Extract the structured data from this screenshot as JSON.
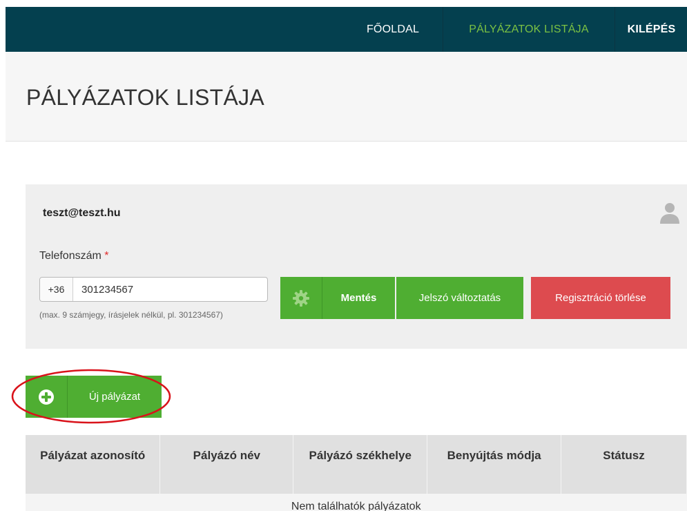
{
  "nav": {
    "home": "FŐOLDAL",
    "list": "PÁLYÁZATOK LISTÁJA",
    "logout": "KILÉPÉS"
  },
  "page": {
    "title": "PÁLYÁZATOK LISTÁJA"
  },
  "profile": {
    "email": "teszt@teszt.hu",
    "phone_label": "Telefonszám",
    "required_mark": "*",
    "prefix": "+36",
    "phone_value": "301234567",
    "hint": "(max. 9 számjegy, írásjelek nélkül, pl. 301234567)",
    "save_label": "Mentés",
    "password_label": "Jelszó változtatás",
    "delete_label": "Regisztráció törlése"
  },
  "actions": {
    "new_label": "Új pályázat"
  },
  "table": {
    "headers": [
      "Pályázat azonosító",
      "Pályázó név",
      "Pályázó székhelye",
      "Benyújtás módja",
      "Státusz"
    ],
    "empty": "Nem találhatók pályázatok"
  },
  "colors": {
    "topbar": "#04404f",
    "nav_active": "#7bc143",
    "button_green": "#4fae32",
    "button_red": "#dd4b4f",
    "highlight_ring": "#d9121a"
  },
  "icons": [
    "gear-icon",
    "user-icon",
    "plus-circle-icon"
  ]
}
